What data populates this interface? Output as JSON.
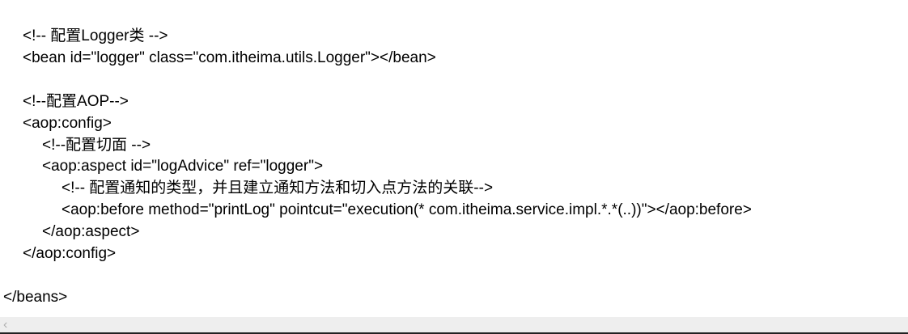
{
  "code_lines": [
    {
      "indent": 1,
      "text": "<!-- 配置Logger类 -->"
    },
    {
      "indent": 1,
      "text": "<bean id=\"logger\" class=\"com.itheima.utils.Logger\"></bean>"
    },
    {
      "indent": 1,
      "text": "<!--配置AOP-->"
    },
    {
      "indent": 1,
      "text": "<aop:config>"
    },
    {
      "indent": 2,
      "text": "<!--配置切面 -->"
    },
    {
      "indent": 2,
      "text": "<aop:aspect id=\"logAdvice\" ref=\"logger\">"
    },
    {
      "indent": 3,
      "text": "<!-- 配置通知的类型，并且建立通知方法和切入点方法的关联-->"
    },
    {
      "indent": 3,
      "text": "<aop:before method=\"printLog\" pointcut=\"execution(* com.itheima.service.impl.*.*(..))\"></aop:before>"
    },
    {
      "indent": 2,
      "text": "</aop:aspect>"
    },
    {
      "indent": 1,
      "text": "</aop:config>"
    },
    {
      "indent": 0,
      "text": "</beans>"
    }
  ],
  "scrollbar": {
    "left_arrow_icon": "chevron-left-icon"
  }
}
